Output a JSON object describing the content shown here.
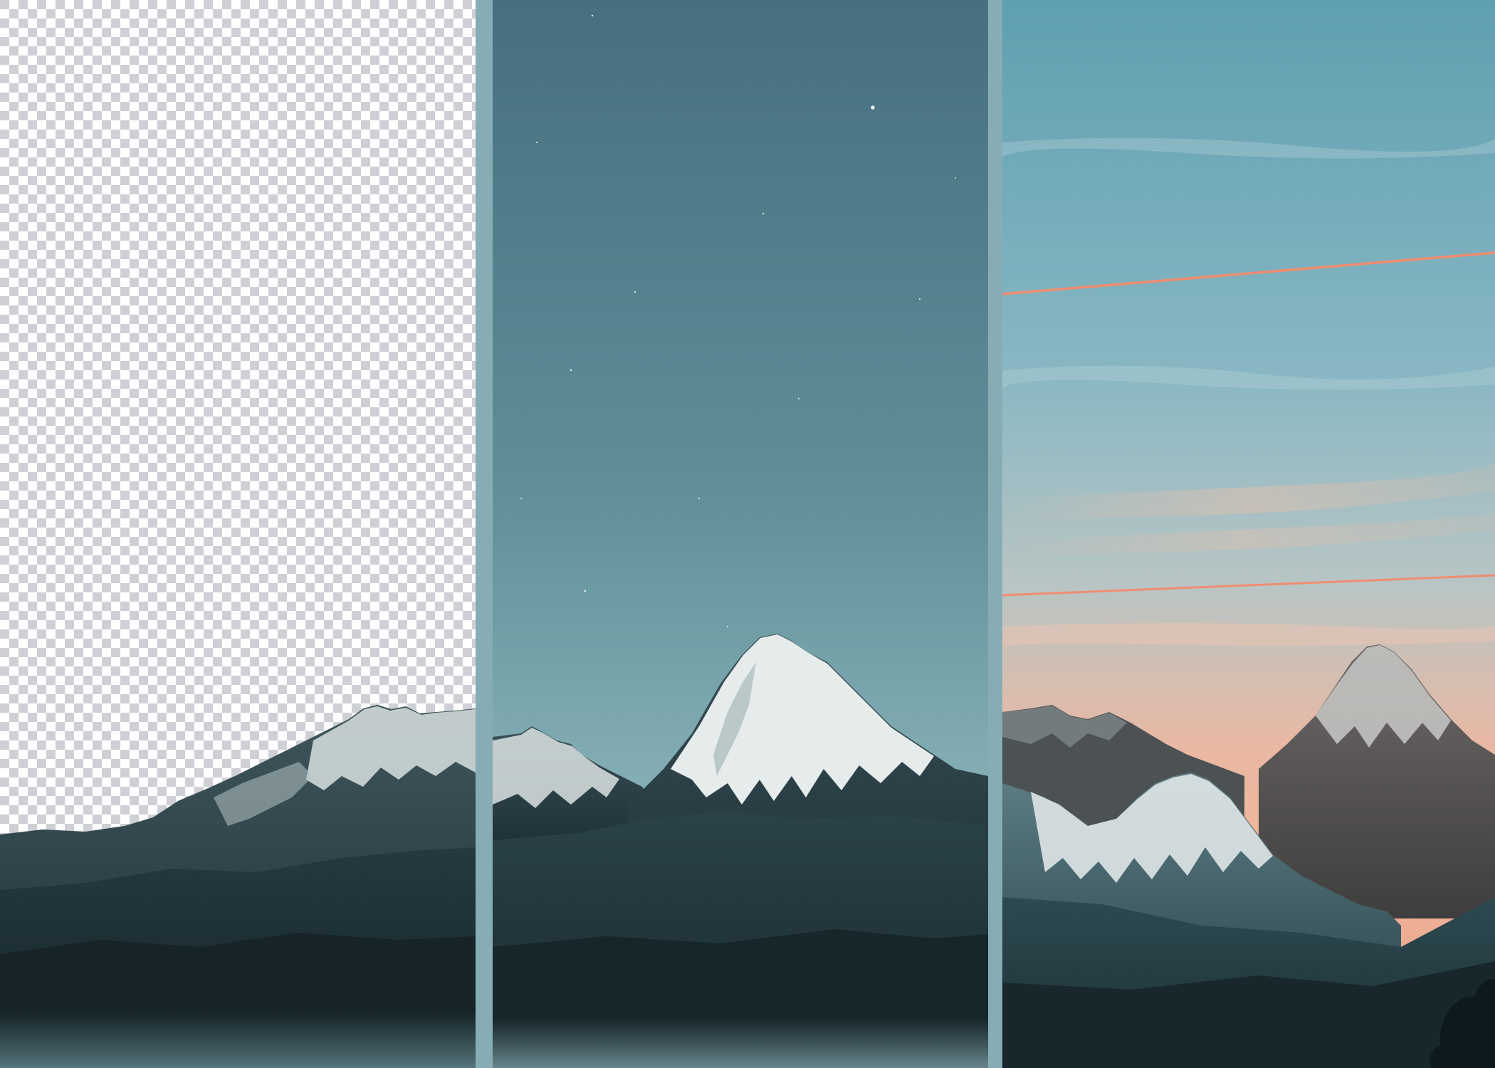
{
  "image": {
    "panels": [
      {
        "label": "transparent-background-cutout"
      },
      {
        "label": "night-sky-composite"
      },
      {
        "label": "sunset-sky-composite"
      }
    ],
    "colors": {
      "divider": "#86acb4",
      "checker_light": "#ffffff",
      "checker_dark": "#cfd0d6",
      "night_sky_top": "#466f7f",
      "night_sky_bottom": "#9bc0c5",
      "sunset_sky_top": "#5f9fb0",
      "sunset_sky_mid": "#9cc1c9",
      "sunset_glow": "#f4b59a",
      "contrail": "#f08d70",
      "mountain_dark": "#1b2f35",
      "snow": "#e6ebeb"
    }
  }
}
